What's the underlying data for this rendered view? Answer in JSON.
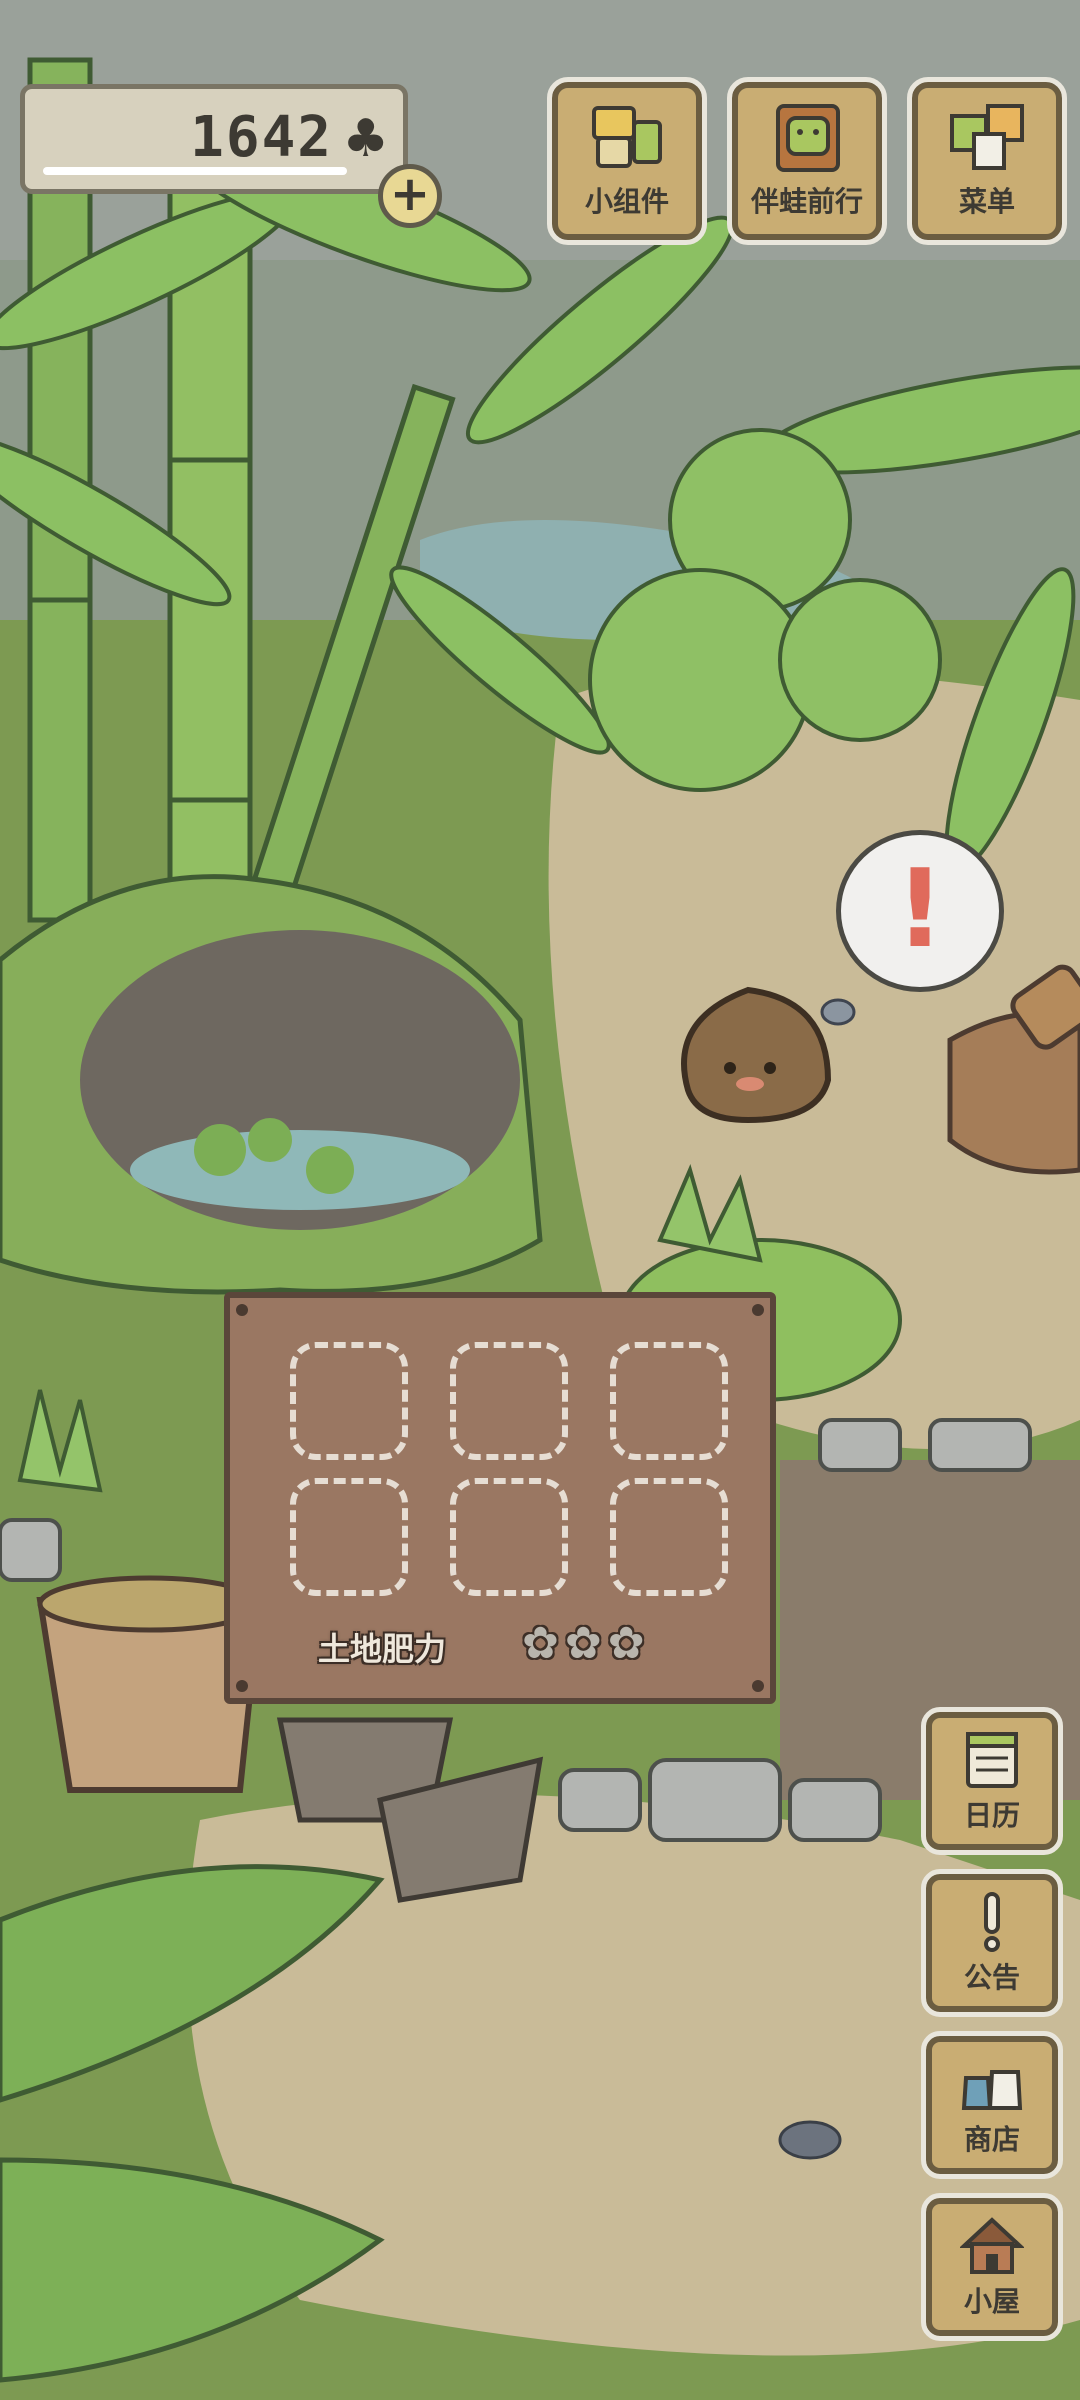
{
  "currency": {
    "amount": "1642",
    "symbol": "♣",
    "add_label": "+"
  },
  "top_buttons": [
    {
      "label": "小组件",
      "icon": "widget-icon"
    },
    {
      "label": "伴蛙前行",
      "icon": "frog-book-icon"
    },
    {
      "label": "菜单",
      "icon": "menu-cards-icon"
    }
  ],
  "side_buttons": [
    {
      "label": "日历",
      "icon": "calendar-icon"
    },
    {
      "label": "公告",
      "icon": "notice-icon"
    },
    {
      "label": "商店",
      "icon": "shop-bags-icon"
    },
    {
      "label": "小屋",
      "icon": "house-icon"
    }
  ],
  "board": {
    "fertility_label": "土地肥力",
    "fertility_stars": "✿✿✿",
    "slot_count": 6
  },
  "alert": {
    "symbol": "!"
  },
  "colors": {
    "grass": "#6f8f47",
    "path": "#c7b99a",
    "button_wood": "#c9ad73",
    "board_wood": "#9a7762",
    "alert_red": "#e06a5b"
  }
}
